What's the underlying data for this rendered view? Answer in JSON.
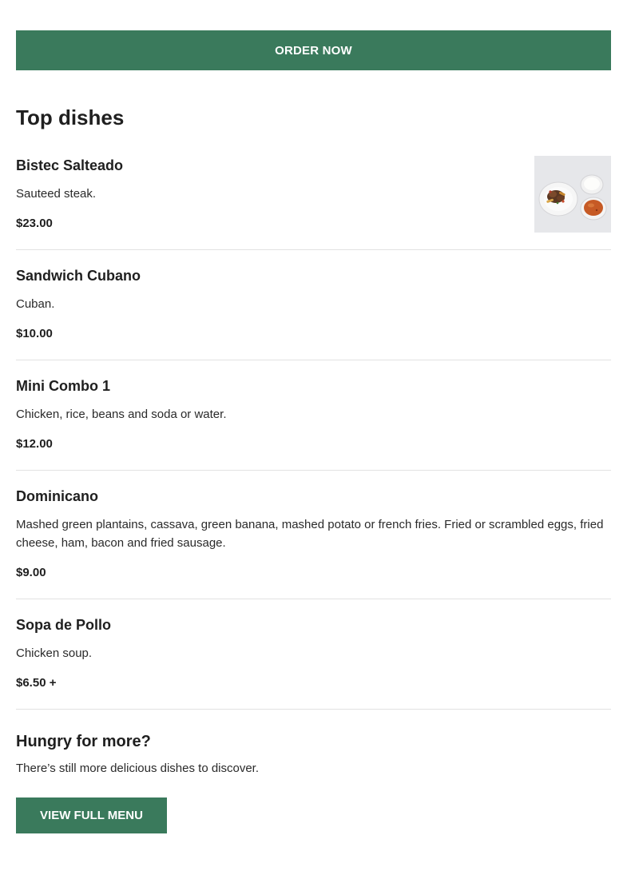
{
  "order_button": {
    "label": "ORDER NOW"
  },
  "top_dishes": {
    "title": "Top dishes",
    "items": [
      {
        "name": "Bistec Salteado",
        "description": "Sauteed steak.",
        "price": "$23.00",
        "image": "plated-steak-rice-beans-photo"
      },
      {
        "name": "Sandwich Cubano",
        "description": "Cuban.",
        "price": "$10.00"
      },
      {
        "name": "Mini Combo 1",
        "description": "Chicken, rice, beans and soda or water.",
        "price": "$12.00"
      },
      {
        "name": "Dominicano",
        "description": "Mashed green plantains, cassava, green banana, mashed potato or french fries. Fried or scrambled eggs, fried cheese, ham, bacon and fried sausage.",
        "price": "$9.00"
      },
      {
        "name": "Sopa de Pollo",
        "description": "Chicken soup.",
        "price": "$6.50 +"
      }
    ]
  },
  "more": {
    "title": "Hungry for more?",
    "text": "There’s still more delicious dishes to discover.",
    "button_label": "VIEW FULL MENU"
  },
  "colors": {
    "accent": "#3a7a5c",
    "divider": "#e2e2e2"
  }
}
